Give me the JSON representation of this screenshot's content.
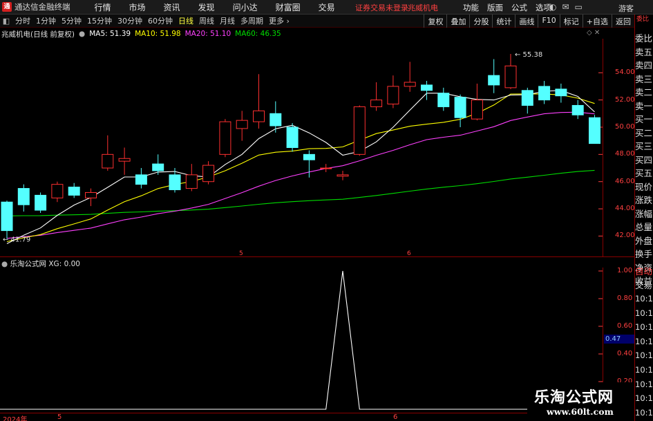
{
  "app": {
    "logo_text": "通",
    "title": "通达信金融终端",
    "menu": [
      "行情",
      "市场",
      "资讯",
      "发现",
      "问小达",
      "财富圈",
      "交易"
    ],
    "status": "证券交易未登录",
    "stock": "兆威机电",
    "right_menu": [
      "功能",
      "版面",
      "公式",
      "选项"
    ],
    "guest": "游客"
  },
  "toolbar": {
    "icon": "◧",
    "periods": [
      "分时",
      "1分钟",
      "5分钟",
      "15分钟",
      "30分钟",
      "60分钟",
      "日线",
      "周线",
      "月线",
      "多周期",
      "更多 ›"
    ],
    "active_index": 6,
    "right_buttons": [
      "复权",
      "叠加",
      "分股",
      "统计",
      "画线",
      "F10",
      "标记",
      "+自选",
      "返回"
    ]
  },
  "info": {
    "stock_name": "兆威机电(日线 前复权)",
    "ma5": "MA5: 51.39",
    "ma10": "MA10: 51.98",
    "ma20": "MA20: 51.10",
    "ma60": "MA60: 46.35",
    "colors": {
      "ma5": "#ffffff",
      "ma10": "#ffff00",
      "ma20": "#ff40ff",
      "ma60": "#00dd00",
      "up": "#ff3030",
      "down": "#54ffff"
    }
  },
  "sidebar": {
    "indicator": "委比",
    "items": [
      "委比",
      "卖五",
      "卖四",
      "卖三",
      "卖二",
      "卖一",
      "买一",
      "买二",
      "买三",
      "买四",
      "买五",
      "现价",
      "涨跌",
      "涨幅",
      "总量",
      "外盘",
      "换手",
      "净资",
      "收益"
    ],
    "auto": "自动",
    "trade": "交易",
    "times": [
      "10:14",
      "10:14",
      "10:14",
      "10:14",
      "10:14",
      "10:14",
      "10:14",
      "10:14",
      "10:14"
    ]
  },
  "price_axis": {
    "min": 40.5,
    "max": 56.5,
    "ticks": [
      "54.00",
      "52.00",
      "50.00",
      "48.00",
      "46.00",
      "44.00",
      "42.00"
    ]
  },
  "annotations": {
    "high": "55.38",
    "low": "41.79"
  },
  "candles": [
    [
      44.5,
      42.4,
      44.6,
      41.8
    ],
    [
      45.5,
      44.3,
      45.8,
      43.8
    ],
    [
      45.0,
      43.9,
      45.2,
      43.7
    ],
    [
      44.8,
      45.8,
      46.0,
      44.5
    ],
    [
      45.6,
      45.0,
      45.9,
      44.8
    ],
    [
      44.8,
      45.2,
      45.5,
      44.2
    ],
    [
      47.0,
      48.0,
      49.4,
      46.8
    ],
    [
      47.5,
      47.7,
      48.5,
      46.5
    ],
    [
      46.5,
      45.8,
      47.0,
      45.5
    ],
    [
      47.3,
      46.8,
      48.0,
      46.5
    ],
    [
      46.5,
      45.4,
      47.0,
      45.2
    ],
    [
      45.5,
      46.5,
      47.3,
      45.3
    ],
    [
      46.0,
      47.2,
      47.5,
      45.8
    ],
    [
      48.0,
      50.4,
      50.6,
      47.8
    ],
    [
      49.9,
      50.5,
      51.2,
      49.0
    ],
    [
      50.4,
      51.2,
      53.9,
      49.9
    ],
    [
      51.0,
      50.1,
      51.9,
      49.6
    ],
    [
      50.0,
      48.5,
      50.3,
      48.2
    ],
    [
      48.0,
      47.6,
      48.3,
      46.3
    ],
    [
      47.0,
      47.0,
      47.3,
      46.7
    ],
    [
      46.4,
      46.5,
      46.8,
      46.1
    ],
    [
      48.0,
      51.5,
      51.6,
      47.9
    ],
    [
      51.5,
      52.0,
      53.3,
      51.2
    ],
    [
      51.7,
      53.0,
      53.8,
      51.4
    ],
    [
      53.0,
      53.3,
      54.8,
      52.6
    ],
    [
      53.1,
      52.7,
      53.4,
      52.0
    ],
    [
      52.5,
      51.5,
      52.9,
      51.2
    ],
    [
      52.2,
      50.7,
      52.4,
      50.0
    ],
    [
      50.6,
      52.0,
      53.2,
      50.5
    ],
    [
      53.8,
      53.1,
      55.0,
      52.5
    ],
    [
      52.9,
      54.5,
      55.38,
      52.8
    ],
    [
      52.7,
      51.6,
      52.9,
      51.0
    ],
    [
      53.0,
      52.0,
      53.4,
      51.7
    ],
    [
      52.8,
      52.3,
      53.2,
      51.8
    ],
    [
      51.6,
      50.9,
      52.0,
      50.6
    ],
    [
      50.7,
      48.8,
      50.9,
      48.8
    ]
  ],
  "indicator": {
    "name": "乐淘公式网",
    "label": "XG: 0.00",
    "axis_ticks": [
      "1.00",
      "0.80",
      "0.60",
      "0.40",
      "0.20"
    ],
    "cursor_value": "0.47",
    "spike_index": 20
  },
  "time_axis": {
    "labels": [
      "2024年",
      "5",
      "6"
    ]
  },
  "markers": {
    "m1": "5",
    "m2": "6"
  },
  "watermark": {
    "cn": "乐淘公式网",
    "url": "www.60lt.com"
  }
}
